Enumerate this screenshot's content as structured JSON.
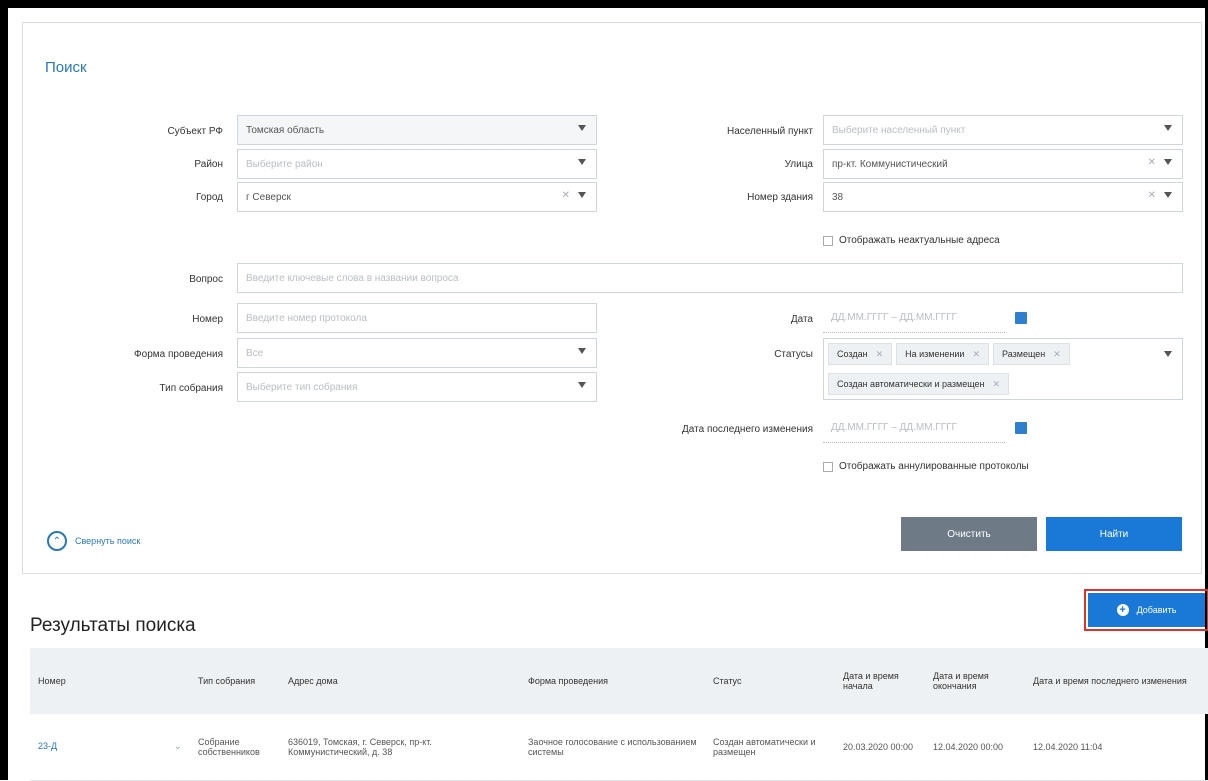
{
  "search": {
    "title": "Поиск",
    "subject_label": "Субъект РФ",
    "subject_value": "Томская область",
    "district_label": "Район",
    "district_placeholder": "Выберите район",
    "city_label": "Город",
    "city_value": "г Северск",
    "locality_label": "Населенный пункт",
    "locality_placeholder": "Выберите населенный пункт",
    "street_label": "Улица",
    "street_value": "пр-кт. Коммунистический",
    "building_label": "Номер здания",
    "building_value": "38",
    "show_noncentral_label": "Отображать неактуальные адреса",
    "question_label": "Вопрос",
    "question_placeholder": "Введите ключевые слова в названии вопроса",
    "number_label": "Номер",
    "number_placeholder": "Введите номер протокола",
    "date_label": "Дата",
    "date_placeholder": "ДД.ММ.ГГГГ – ДД.ММ.ГГГГ",
    "form_label": "Форма проведения",
    "form_value": "Все",
    "statuses_label": "Статусы",
    "statuses": [
      "Создан",
      "На изменении",
      "Размещен",
      "Создан автоматически и размещен"
    ],
    "meeting_type_label": "Тип собрания",
    "meeting_type_placeholder": "Выберите тип собрания",
    "last_change_label": "Дата последнего изменения",
    "last_change_placeholder": "ДД.ММ.ГГГГ – ДД.ММ.ГГГГ",
    "show_cancelled_label": "Отображать аннулированные протоколы",
    "collapse_label": "Свернуть поиск",
    "clear_button": "Очистить",
    "find_button": "Найти"
  },
  "results": {
    "title": "Результаты поиска",
    "add_button": "Добавить",
    "columns": [
      "Номер",
      "Тип собрания",
      "Адрес дома",
      "Форма проведения",
      "Статус",
      "Дата и время начала",
      "Дата и время окончания",
      "Дата и время последнего изменения"
    ],
    "rows": [
      {
        "number": "23-Д",
        "type": "Собрание собственников",
        "address": "636019, Томская, г. Северск, пр-кт. Коммунистический, д. 38",
        "form": "Заочное голосование с использованием системы",
        "status": "Создан автоматически и размещен",
        "start": "20.03.2020 00:00",
        "end": "12.04.2020 00:00",
        "changed": "12.04.2020 11:04"
      }
    ]
  },
  "colors": {
    "accent": "#1a78d6",
    "title": "#2a78b8",
    "clear_button": "#6e7a85",
    "highlight": "#d9352b"
  }
}
